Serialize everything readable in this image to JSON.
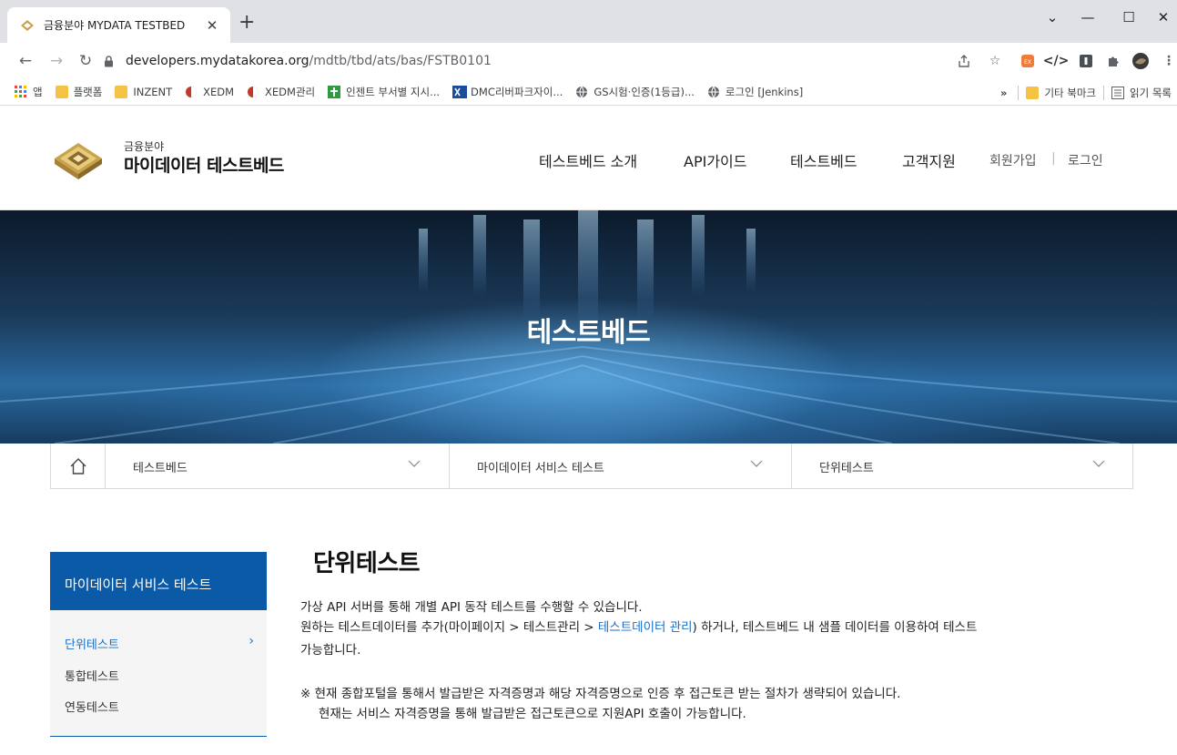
{
  "browser": {
    "tab_title": "금융분야 MYDATA TESTBED",
    "tab_close": "✕",
    "new_tab": "+",
    "window": {
      "minimize": "—",
      "maximize": "☐",
      "close": "✕",
      "tablist": "⌄"
    },
    "url_host": "developers.mydatakorea.org",
    "url_path": "/mdtb/tbd/ats/bas/FSTB0101",
    "nav": {
      "back": "←",
      "forward": "→",
      "reload": "↻"
    },
    "bookmarks": [
      {
        "label": "앱",
        "icon": "apps-icon"
      },
      {
        "label": "플랫폼",
        "icon": "folder-icon"
      },
      {
        "label": "INZENT",
        "icon": "folder-icon"
      },
      {
        "label": "XEDM",
        "icon": "xedm-icon"
      },
      {
        "label": "XEDM관리",
        "icon": "xedm-icon"
      },
      {
        "label": "인젠트 부서별 지시...",
        "icon": "inzent-icon"
      },
      {
        "label": "DMC리버파크자이...",
        "icon": "dmc-icon"
      },
      {
        "label": "GS시험·인증(1등급)...",
        "icon": "globe-icon"
      },
      {
        "label": "로그인 [Jenkins]",
        "icon": "globe-icon"
      }
    ],
    "bookmarks_more": "»",
    "bookmarks_other": "기타 북마크",
    "reading_list": "읽기 목록"
  },
  "site": {
    "logo_small": "금융분야",
    "logo_big": "마이데이터 테스트베드",
    "gnb": [
      "테스트베드 소개",
      "API가이드",
      "테스트베드",
      "고객지원"
    ],
    "util": {
      "join": "회원가입",
      "divider": "|",
      "login": "로그인"
    },
    "hero_title": "테스트베드",
    "location": [
      "테스트베드",
      "마이데이터 서비스 테스트",
      "단위테스트"
    ]
  },
  "lnb": {
    "title": "마이데이터 서비스 테스트",
    "items": [
      "단위테스트",
      "통합테스트",
      "연동테스트"
    ],
    "active_arrow": "›"
  },
  "content": {
    "title": "단위테스트",
    "line1": "가상 API 서버를 통해 개별 API 동작 테스트를 수행할 수 있습니다.",
    "line2_pre": "원하는 테스트데이터를 추가(마이페이지 > 테스트관리 > ",
    "line2_link": "테스트데이터 관리",
    "line2_post": ") 하거나, 테스트베드 내 샘플 데이터를 이용하여 테스트",
    "line3": "가능합니다.",
    "note1": "※ 현재 종합포털을 통해서 발급받은 자격증명과 해당 자격증명으로 인증 후 접근토큰 받는 절차가 생략되어 있습니다.",
    "note2": "현재는 서비스 자격증명을 통해 발급받은 접근토큰으로 지원API 호출이 가능합니다."
  },
  "colors": {
    "primary": "#0b5aa8",
    "link": "#1c6ec4",
    "lnb_bg": "#f5f5f5"
  }
}
